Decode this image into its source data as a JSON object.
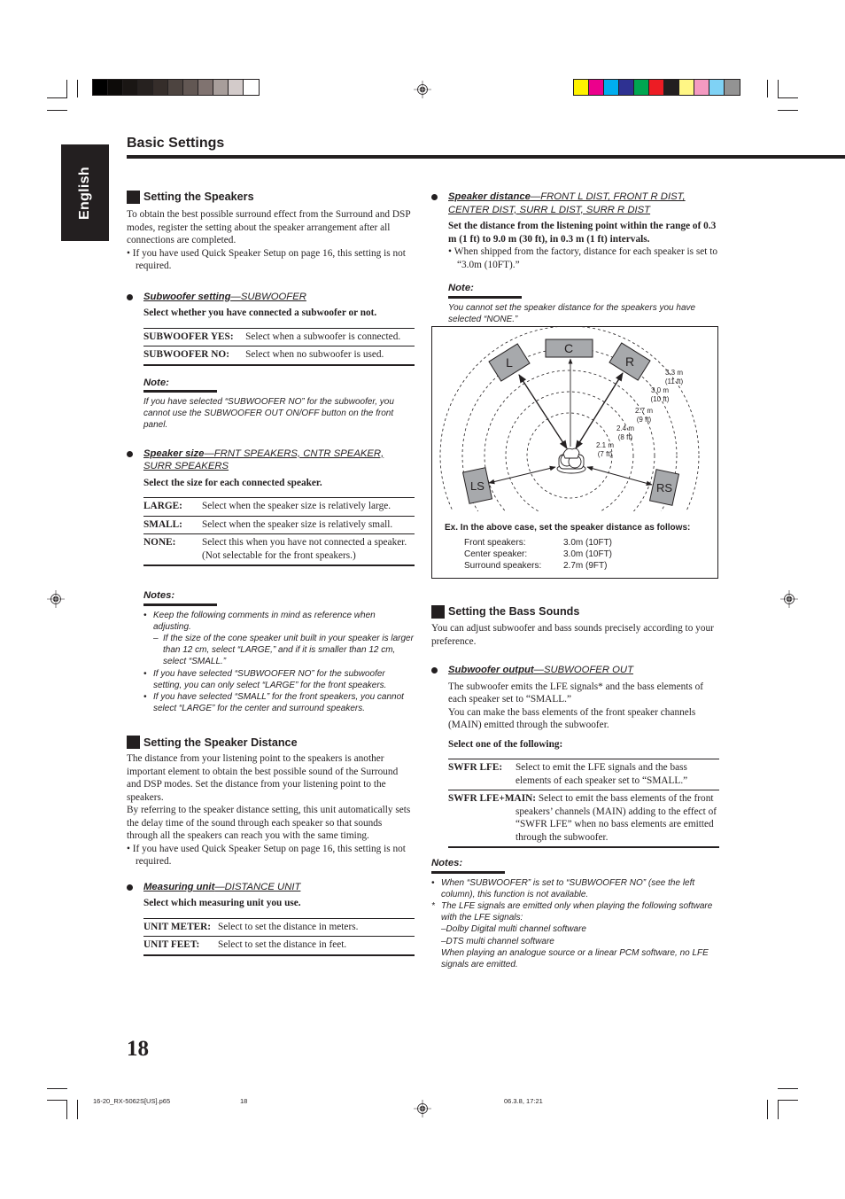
{
  "print_marks": {
    "grayscale_swatches": [
      "#000000",
      "#0d0b09",
      "#1a1614",
      "#26211f",
      "#352d2a",
      "#4d4440",
      "#625753",
      "#807370",
      "#a89e9b",
      "#d3cbca",
      "#ffffff"
    ],
    "color_swatches": [
      "#fff200",
      "#ec008c",
      "#00aeef",
      "#2e3192",
      "#00a651",
      "#ed1c24",
      "#231f20",
      "#fff685",
      "#f49ac1",
      "#7fd2f5",
      "#939393"
    ]
  },
  "language_tab": "English",
  "page_title": "Basic Settings",
  "left": {
    "speakers": {
      "heading": "Setting the Speakers",
      "intro": "To obtain the best possible surround effect from the Surround and DSP modes, register the setting about the speaker arrangement after all connections are completed.",
      "bullet": "If you have used Quick Speaker Setup on page 16, this setting is not required."
    },
    "subwoofer_setting": {
      "head_bold": "Subwoofer setting",
      "head_rest": "—SUBWOOFER",
      "instruction": "Select whether you have connected a subwoofer or not.",
      "options": [
        {
          "key": "SUBWOOFER YES:",
          "desc": "Select when a subwoofer is connected."
        },
        {
          "key": "SUBWOOFER NO:",
          "desc": "Select when no subwoofer is used."
        }
      ],
      "note_heading": "Note:",
      "note": "If you have selected “SUBWOOFER NO” for the subwoofer, you cannot use the SUBWOOFER OUT ON/OFF button on the front panel."
    },
    "speaker_size": {
      "head_bold": "Speaker size",
      "head_rest": "—FRNT SPEAKERS, CNTR SPEAKER, SURR SPEAKERS",
      "instruction": "Select the size for each connected speaker.",
      "options": [
        {
          "key": "LARGE:",
          "desc": "Select when the speaker size is relatively large."
        },
        {
          "key": "SMALL:",
          "desc": "Select when the speaker size is relatively small."
        },
        {
          "key": "NONE:",
          "desc": "Select this when you have not connected a speaker. (Not selectable for the front speakers.)"
        }
      ],
      "notes_heading": "Notes:",
      "notes": [
        {
          "mark": "•",
          "text": "Keep the following comments in mind as reference when adjusting."
        },
        {
          "mark": "–",
          "text": "If the size of the cone speaker unit built in your speaker is larger than 12 cm, select “LARGE,” and if it is smaller than 12 cm, select “SMALL.”",
          "sub": true
        },
        {
          "mark": "•",
          "text": "If you have selected “SUBWOOFER NO” for the subwoofer setting, you can only select “LARGE” for the front speakers."
        },
        {
          "mark": "•",
          "text": "If you have selected “SMALL” for the front speakers, you cannot select “LARGE” for the center and surround speakers."
        }
      ]
    },
    "distance": {
      "heading": "Setting the Speaker Distance",
      "intro1": "The distance from your listening point to the speakers is another important element to obtain the best possible sound of the Surround and DSP modes. Set the distance from your listening point to the speakers.",
      "intro2": "By referring to the speaker distance setting, this unit automatically sets the delay time of the sound through each speaker so that sounds through all the speakers can reach you with the same timing.",
      "bullet": "If you have used Quick Speaker Setup on page 16, this setting is not required."
    },
    "measuring_unit": {
      "head_bold": "Measuring unit",
      "head_rest": "—DISTANCE UNIT",
      "instruction": "Select which measuring unit you use.",
      "options": [
        {
          "key": "UNIT METER:",
          "desc": "Select to set the distance in meters."
        },
        {
          "key": "UNIT FEET:",
          "desc": "Select to set the distance in feet."
        }
      ]
    }
  },
  "right": {
    "speaker_distance": {
      "head_bold": "Speaker distance",
      "head_rest": "—FRONT L DIST, FRONT R DIST, CENTER DIST, SURR L DIST, SURR R DIST",
      "instruction": "Set the distance from the listening point within the range of 0.3 m (1 ft) to 9.0 m (30 ft), in 0.3 m (1 ft) intervals.",
      "bullet": "When shipped from the factory, distance for each speaker is set to “3.0m (10FT).”",
      "note_heading": "Note:",
      "note": "You cannot set the speaker distance for the speakers you have selected “NONE.”"
    },
    "diagram": {
      "speakers": [
        "L",
        "C",
        "R",
        "LS",
        "RS"
      ],
      "rings": [
        {
          "m": "2.1 m",
          "ft": "(7 ft)"
        },
        {
          "m": "2.4 m",
          "ft": "(8 ft)"
        },
        {
          "m": "2.7 m",
          "ft": "(9 ft)"
        },
        {
          "m": "3.0 m",
          "ft": "(10 ft)"
        },
        {
          "m": "3.3 m",
          "ft": "(11 ft)"
        }
      ],
      "example_heading": "Ex. In the above case, set the speaker distance as follows:",
      "example_rows": [
        {
          "label": "Front speakers:",
          "value": "3.0m (10FT)"
        },
        {
          "label": "Center speaker:",
          "value": "3.0m (10FT)"
        },
        {
          "label": "Surround speakers:",
          "value": "2.7m (9FT)"
        }
      ]
    },
    "bass": {
      "heading": "Setting the Bass Sounds",
      "intro": "You can adjust subwoofer and bass sounds precisely according to your preference.",
      "head_bold": "Subwoofer output",
      "head_rest": "—SUBWOOFER OUT",
      "desc1": "The subwoofer emits the LFE signals* and the bass elements of each speaker set to “SMALL.”",
      "desc2": "You can make the bass elements of the front speaker channels (MAIN) emitted through the subwoofer.",
      "instruction": "Select one of the following:",
      "options": [
        {
          "key": "SWFR LFE:",
          "desc": "Select to emit the LFE signals and the bass elements of each speaker set to “SMALL.”"
        },
        {
          "key": "SWFR LFE+MAIN:",
          "desc": "Select to emit the bass elements of the front speakers’ channels (MAIN) adding to the effect of “SWFR LFE” when no bass elements are emitted through the subwoofer."
        }
      ],
      "notes_heading": "Notes:",
      "notes": [
        {
          "mark": "•",
          "text": "When “SUBWOOFER” is set to “SUBWOOFER NO” (see the left column), this function is not available."
        },
        {
          "mark": "*",
          "text": "The LFE signals are emitted only when playing the following software with the LFE signals:"
        },
        {
          "mark": "",
          "text": "–Dolby Digital multi channel software"
        },
        {
          "mark": "",
          "text": "–DTS multi channel software"
        },
        {
          "mark": "",
          "text": "When playing an analogue source or a linear PCM software, no LFE signals are emitted."
        }
      ]
    }
  },
  "page_number": "18",
  "footer": {
    "file": "16-20_RX-5062S[US].p65",
    "page": "18",
    "date": "06.3.8, 17:21"
  }
}
